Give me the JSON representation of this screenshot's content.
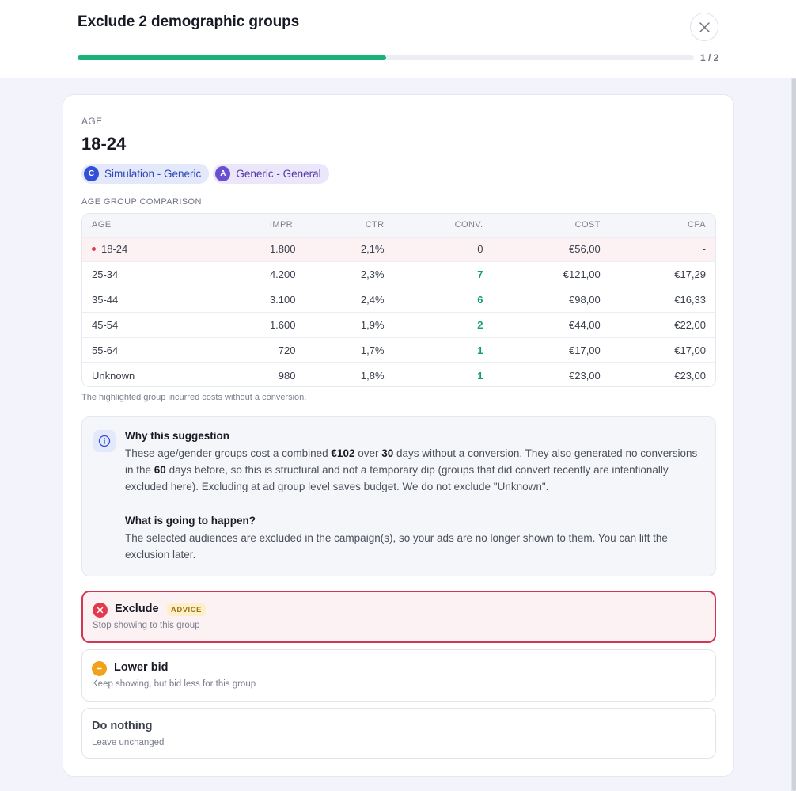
{
  "header": {
    "title": "Exclude 2 demographic groups",
    "step": "1 / 2",
    "progress": 0.5
  },
  "group": {
    "label": "AGE",
    "value": "18-24",
    "chips": [
      {
        "letter": "C",
        "name": "Simulation - Generic"
      },
      {
        "letter": "A",
        "name": "Generic - General"
      }
    ]
  },
  "comparison": {
    "heading": "AGE GROUP COMPARISON",
    "columns": [
      "AGE",
      "IMPR.",
      "CTR",
      "CONV.",
      "COST",
      "CPA"
    ],
    "rows": [
      {
        "age": "18-24",
        "impr": "1.800",
        "ctr": "2,1%",
        "conv": "0",
        "cost": "€56,00",
        "cpa": "-"
      },
      {
        "age": "25-34",
        "impr": "4.200",
        "ctr": "2,3%",
        "conv": "7",
        "cost": "€121,00",
        "cpa": "€17,29"
      },
      {
        "age": "35-44",
        "impr": "3.100",
        "ctr": "2,4%",
        "conv": "6",
        "cost": "€98,00",
        "cpa": "€16,33"
      },
      {
        "age": "45-54",
        "impr": "1.600",
        "ctr": "1,9%",
        "conv": "2",
        "cost": "€44,00",
        "cpa": "€22,00"
      },
      {
        "age": "55-64",
        "impr": "720",
        "ctr": "1,7%",
        "conv": "1",
        "cost": "€17,00",
        "cpa": "€17,00"
      },
      {
        "age": "Unknown",
        "impr": "980",
        "ctr": "1,8%",
        "conv": "1",
        "cost": "€23,00",
        "cpa": "€23,00"
      }
    ],
    "note": "The highlighted group incurred costs without a conversion."
  },
  "why": {
    "title": "Why this suggestion",
    "body_1": "These age/gender groups cost a combined ",
    "amount": "€102",
    "body_2": " over ",
    "days": "30",
    "body_3": " days without a conversion. They also generated no conversions in the ",
    "prior_days": "60",
    "body_4": " days before, so this is structural and not a temporary dip (groups that did convert recently are intentionally excluded here). Excluding at ad group level saves budget. We do not exclude \"Unknown\".",
    "what_title": "What is going to happen?",
    "what_body": "The selected audiences are excluded in the campaign(s), so your ads are no longer shown to them. You can lift the exclusion later."
  },
  "options": {
    "exclude": {
      "title": "Exclude",
      "badge": "ADVICE",
      "sub": "Stop showing to this group"
    },
    "lower": {
      "title": "Lower bid",
      "sub": "Keep showing, but bid less for this group"
    },
    "nothing": {
      "title": "Do nothing",
      "sub": "Leave unchanged"
    }
  },
  "colors": {
    "accent_green": "#19b379",
    "danger": "#d23655",
    "warning": "#f0a21c",
    "info": "#3450d6"
  }
}
